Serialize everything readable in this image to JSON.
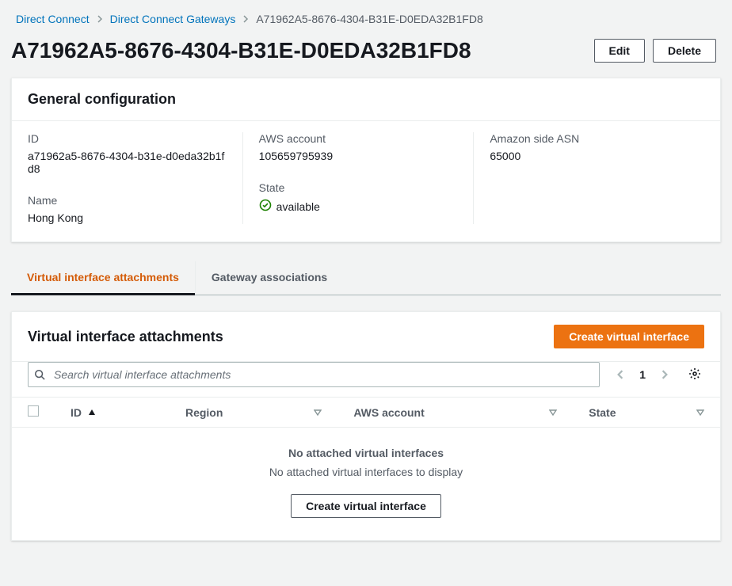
{
  "breadcrumb": {
    "root": "Direct Connect",
    "section": "Direct Connect Gateways",
    "current": "A71962A5-8676-4304-B31E-D0EDA32B1FD8"
  },
  "page": {
    "title": "A71962A5-8676-4304-B31E-D0EDA32B1FD8",
    "edit_label": "Edit",
    "delete_label": "Delete"
  },
  "general_config": {
    "panel_title": "General configuration",
    "id_label": "ID",
    "id_value": "a71962a5-8676-4304-b31e-d0eda32b1fd8",
    "name_label": "Name",
    "name_value": "Hong Kong",
    "account_label": "AWS account",
    "account_value": "105659795939",
    "state_label": "State",
    "state_value": "available",
    "asn_label": "Amazon side ASN",
    "asn_value": "65000"
  },
  "tabs": {
    "attachments": "Virtual interface attachments",
    "associations": "Gateway associations"
  },
  "vif_panel": {
    "panel_title": "Virtual interface attachments",
    "create_label": "Create virtual interface",
    "search_placeholder": "Search virtual interface attachments",
    "page_number": "1",
    "columns": {
      "id": "ID",
      "region": "Region",
      "account": "AWS account",
      "state": "State"
    },
    "empty": {
      "title": "No attached virtual interfaces",
      "subtitle": "No attached virtual interfaces to display",
      "action": "Create virtual interface"
    }
  },
  "colors": {
    "link": "#0073bb",
    "primary": "#ec7211",
    "success": "#1d8102"
  }
}
